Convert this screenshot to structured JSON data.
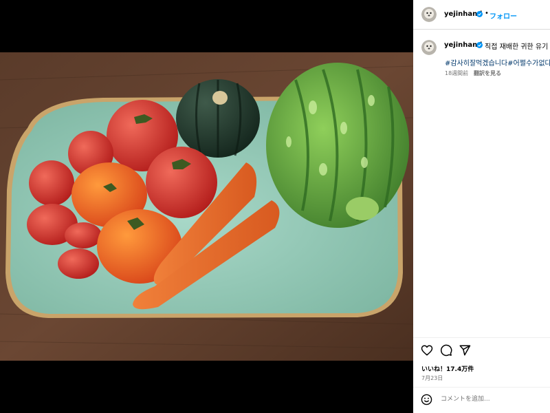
{
  "post": {
    "username": "yejinhand",
    "follow_label": "フォロー",
    "separator": "•",
    "photo_alt": "vegetables-on-tray-photo"
  },
  "caption": {
    "username": "yejinhand",
    "text": "직접 재배한 귀한 유기",
    "hashtags": "#감사히잘먹겠습니다#어쩔수가없다",
    "time_ago": "18週間前",
    "translate_label": "翻訳を見る"
  },
  "actions": {
    "icons": [
      "heart-icon",
      "comment-icon",
      "share-icon"
    ],
    "likes": "いいね！17.4万件",
    "date": "7月23日"
  },
  "comment": {
    "placeholder": "コメントを追加...",
    "emoji_icon": "emoji-icon"
  },
  "colors": {
    "follow": "#0095f6",
    "hashtag": "#00376b",
    "verified": "#0095f6",
    "muted": "#737373"
  }
}
